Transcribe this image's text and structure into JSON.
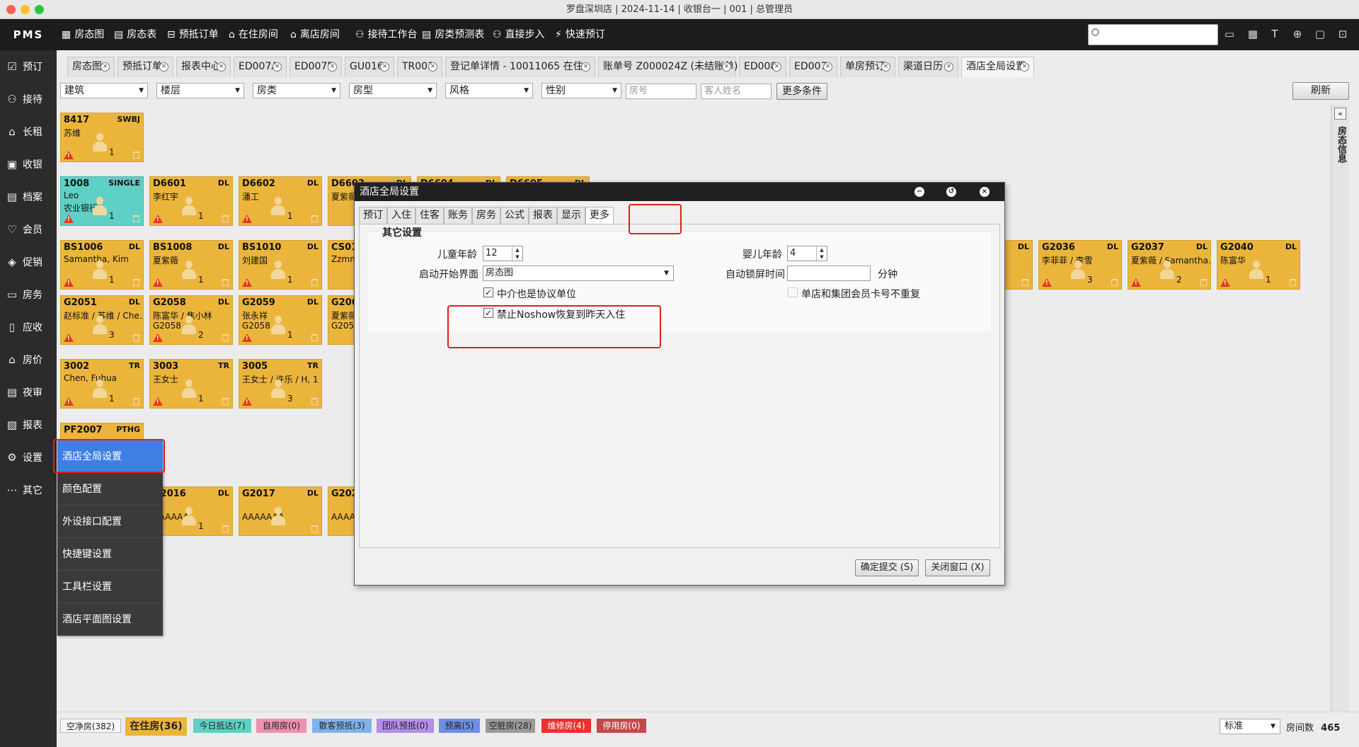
{
  "window_title": "罗盘深圳店 | 2024-11-14 | 收银台一 | 001 | 总管理员",
  "logo": "PMS",
  "topnav": [
    {
      "icon": "▦",
      "label": "房态图",
      "name": "room-status-map"
    },
    {
      "icon": "▤",
      "label": "房态表",
      "name": "room-status-table"
    },
    {
      "icon": "⊟",
      "label": "预抵订单",
      "name": "expected-arrivals"
    },
    {
      "icon": "⌂",
      "label": "在住房间",
      "name": "occupied-rooms"
    },
    {
      "icon": "⌂",
      "label": "离店房间",
      "name": "departed-rooms"
    },
    {
      "icon": "⚇",
      "label": "接待工作台",
      "name": "reception-desk"
    },
    {
      "icon": "▤",
      "label": "房类预测表",
      "name": "forecast-table"
    },
    {
      "icon": "⚇",
      "label": "直接步入",
      "name": "walk-in"
    },
    {
      "icon": "⚡",
      "label": "快速预订",
      "name": "quick-booking"
    }
  ],
  "search": {
    "value": "",
    "placeholder": ""
  },
  "top_icons": [
    "message-icon",
    "calculator-icon",
    "font-icon",
    "globe-icon",
    "bag-icon",
    "lock-icon"
  ],
  "sidebar": [
    {
      "icon": "☑",
      "label": "预订",
      "name": "booking"
    },
    {
      "icon": "⚇",
      "label": "接待",
      "name": "reception"
    },
    {
      "icon": "⌂",
      "label": "长租",
      "name": "long-rent"
    },
    {
      "icon": "▣",
      "label": "收银",
      "name": "cashier"
    },
    {
      "icon": "▤",
      "label": "档案",
      "name": "archive"
    },
    {
      "icon": "♡",
      "label": "会员",
      "name": "member"
    },
    {
      "icon": "◈",
      "label": "促销",
      "name": "promotion"
    },
    {
      "icon": "▭",
      "label": "房务",
      "name": "housekeeping"
    },
    {
      "icon": "▯",
      "label": "应收",
      "name": "receivable"
    },
    {
      "icon": "⌂",
      "label": "房价",
      "name": "room-rate"
    },
    {
      "icon": "▤",
      "label": "夜审",
      "name": "night-audit"
    },
    {
      "icon": "▨",
      "label": "报表",
      "name": "reports"
    },
    {
      "icon": "⚙",
      "label": "设置",
      "name": "settings"
    },
    {
      "icon": "⋯",
      "label": "其它",
      "name": "others"
    }
  ],
  "tabs": [
    "房态图",
    "预抵订单",
    "报表中心",
    "ED007A",
    "ED007B",
    "GU016",
    "TR003",
    "登记单详情 - 10011065 在住",
    "账单号 Z000024Z (未结账单)",
    "ED008",
    "ED007",
    "单房预订",
    "渠道日历",
    "酒店全局设置"
  ],
  "filters": {
    "dropdowns": [
      "建筑",
      "楼层",
      "房类",
      "房型",
      "风格",
      "性别"
    ],
    "room_no_placeholder": "房号",
    "guest_placeholder": "客人姓名",
    "more_btn": "更多条件",
    "refresh_btn": "刷新"
  },
  "side_panel_label": "房态信息",
  "rooms": [
    {
      "no": "8417",
      "type": "SWBJ",
      "guest": "苏维",
      "line2": "",
      "count": "1",
      "teal": false
    },
    {
      "no": "1008",
      "type": "SINGLE",
      "guest": "Leo",
      "line2": "农业银行",
      "count": "1",
      "teal": true
    },
    {
      "no": "D6601",
      "type": "DL",
      "guest": "李红宇",
      "line2": "",
      "count": "1",
      "teal": false
    },
    {
      "no": "D6602",
      "type": "DL",
      "guest": "潘工",
      "line2": "",
      "count": "1",
      "teal": false
    },
    {
      "no": "D6603",
      "type": "DL",
      "guest": "夏紫薇",
      "line2": "",
      "count": "",
      "teal": false
    },
    {
      "no": "D6604",
      "type": "DL",
      "guest": "",
      "line2": "",
      "count": "",
      "teal": false
    },
    {
      "no": "D6605",
      "type": "DL",
      "guest": "",
      "line2": "",
      "count": "",
      "teal": false
    },
    {
      "no": "BS1006",
      "type": "DL",
      "guest": "Samantha, Kim",
      "line2": "",
      "count": "1",
      "teal": false
    },
    {
      "no": "BS1008",
      "type": "DL",
      "guest": "夏紫薇",
      "line2": "",
      "count": "1",
      "teal": false
    },
    {
      "no": "BS1010",
      "type": "DL",
      "guest": "刘建国",
      "line2": "",
      "count": "1",
      "teal": false
    },
    {
      "no": "CS01",
      "type": "",
      "guest": "Zzmm",
      "line2": "",
      "count": "",
      "teal": false
    },
    {
      "no": "G2051",
      "type": "DL",
      "guest": "赵标准 / 苏维 / Che...",
      "line2": "",
      "count": "3",
      "teal": false
    },
    {
      "no": "G2058",
      "type": "DL",
      "guest": "陈富华 / 焦小林",
      "line2": "G2058",
      "count": "2",
      "teal": false
    },
    {
      "no": "G2059",
      "type": "DL",
      "guest": "张永祥",
      "line2": "G2058",
      "count": "1",
      "teal": false
    },
    {
      "no": "G2060",
      "type": "",
      "guest": "夏紫薇",
      "line2": "G2058",
      "count": "",
      "teal": false
    },
    {
      "no": "3002",
      "type": "TR",
      "guest": "Chen, Fuhua",
      "line2": "",
      "count": "1",
      "teal": false
    },
    {
      "no": "3003",
      "type": "TR",
      "guest": "王女士",
      "line2": "",
      "count": "1",
      "teal": false
    },
    {
      "no": "3005",
      "type": "TR",
      "guest": "王女士 / 许乐 / H, 1",
      "line2": "",
      "count": "3",
      "teal": false
    },
    {
      "no": "PF2007",
      "type": "PTHG",
      "guest": "",
      "line2": "",
      "count": "",
      "teal": false
    },
    {
      "no": "G2016",
      "type": "DL",
      "guest": "乐",
      "line2": "AAAAAA",
      "count": "1",
      "teal": false
    },
    {
      "no": "G2017",
      "type": "DL",
      "guest": "",
      "line2": "AAAAAAA",
      "count": "",
      "teal": false
    },
    {
      "no": "G2020",
      "type": "",
      "guest": "",
      "line2": "AAAA",
      "count": "",
      "teal": false
    },
    {
      "no": "G2034",
      "type": "DL",
      "guest": "",
      "line2": "",
      "count": "",
      "teal": false
    },
    {
      "no": "G2036",
      "type": "DL",
      "guest": "李菲菲 / 李雪",
      "line2": "",
      "count": "3",
      "teal": false
    },
    {
      "no": "G2037",
      "type": "DL",
      "guest": "夏紫薇 / Samantha...",
      "line2": "",
      "count": "2",
      "teal": false
    },
    {
      "no": "G2040",
      "type": "DL",
      "guest": "陈富华",
      "line2": "",
      "count": "1",
      "teal": false
    }
  ],
  "settings_menu": [
    "酒店全局设置",
    "颜色配置",
    "外设接口配置",
    "快捷键设置",
    "工具栏设置",
    "酒店平面图设置"
  ],
  "dialog": {
    "title": "酒店全局设置",
    "tabs": [
      "预订",
      "入住",
      "住客",
      "账务",
      "房务",
      "公式",
      "报表",
      "显示",
      "更多"
    ],
    "active_tab": "更多",
    "group_title": "其它设置",
    "child_age_label": "儿童年龄",
    "child_age_value": "12",
    "infant_age_label": "婴儿年龄",
    "infant_age_value": "4",
    "start_screen_label": "启动开始界面",
    "start_screen_value": "房态图",
    "auto_lock_label": "自动锁屏时间",
    "auto_lock_value": "",
    "auto_lock_unit": "分钟",
    "chk_agent": "中介也是协议单位",
    "chk_agent_checked": true,
    "chk_noshow": "禁止Noshow恢复到昨天入住",
    "chk_noshow_checked": true,
    "chk_card": "单店和集团会员卡号不重复",
    "chk_card_checked": false,
    "confirm_btn": "确定提交 (S)",
    "close_btn": "关闭窗口 (X)"
  },
  "status_bar": [
    {
      "label": "空净房(382)",
      "color": "#f7f7f7",
      "text": "#222",
      "name": "status-vacant-clean"
    },
    {
      "label": "在住房(36)",
      "color": "#ebb53c",
      "text": "#222",
      "name": "status-occupied"
    },
    {
      "label": "今日抵达(7)",
      "color": "#5fd0c5",
      "text": "#222",
      "name": "status-arrivals-today"
    },
    {
      "label": "自用房(0)",
      "color": "#f08fb0",
      "text": "#222",
      "name": "status-house-use"
    },
    {
      "label": "散客预抵(3)",
      "color": "#7fb3ee",
      "text": "#222",
      "name": "status-fit-arrivals"
    },
    {
      "label": "团队预抵(0)",
      "color": "#b48ee8",
      "text": "#222",
      "name": "status-group-arrivals"
    },
    {
      "label": "预离(5)",
      "color": "#6e8ee8",
      "text": "#222",
      "name": "status-expected-departure"
    },
    {
      "label": "空脏房(28)",
      "color": "#9a9a9a",
      "text": "#222",
      "name": "status-vacant-dirty"
    },
    {
      "label": "维修房(4)",
      "color": "#ef2e2e",
      "text": "#fff",
      "name": "status-maintenance"
    },
    {
      "label": "停用房(0)",
      "color": "#c44a4a",
      "text": "#fff",
      "name": "status-out-of-service"
    }
  ],
  "view_mode": "标准",
  "room_count_label": "房间数",
  "room_count": "465"
}
